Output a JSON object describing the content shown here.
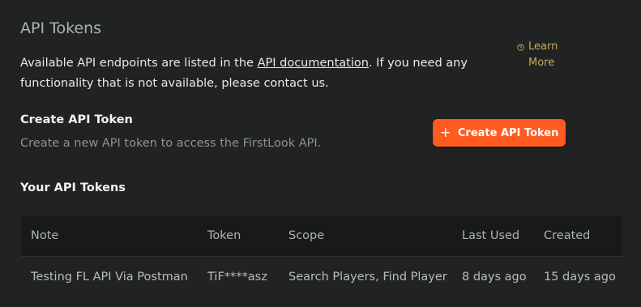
{
  "page": {
    "title": "API Tokens",
    "intro_before": "Available API endpoints are listed in the ",
    "intro_link": "API documentation",
    "intro_after": ". If you need any functionality that is not available, please contact us.",
    "learn_more_line1": "Learn",
    "learn_more_line2": "More"
  },
  "create": {
    "title": "Create API Token",
    "subtitle": "Create a new API token to access the FirstLook API.",
    "button_label": "Create API Token",
    "button_color": "#ff5a1f"
  },
  "tokens": {
    "title": "Your API Tokens",
    "columns": [
      "Note",
      "Token",
      "Scope",
      "Last Used",
      "Created"
    ],
    "rows": [
      {
        "note": "Testing FL API Via Postman",
        "token": "TiF****asz",
        "scope": "Search Players, Find Player",
        "last_used": "8 days ago",
        "created": "15 days ago"
      }
    ]
  },
  "icons": {
    "learn_more": "question-circle-icon",
    "create_button": "plus-icon"
  }
}
